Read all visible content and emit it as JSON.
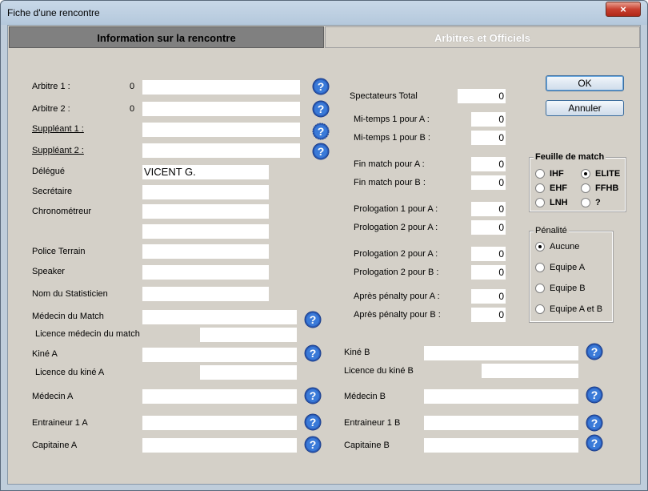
{
  "window": {
    "title": "Fiche d'une rencontre",
    "close": "×"
  },
  "tabs": [
    {
      "label": "Information sur la rencontre"
    },
    {
      "label": "Arbitres et Officiels"
    }
  ],
  "left": {
    "arbitre1": {
      "label": "Arbitre 1 :",
      "count": "0",
      "value": ""
    },
    "arbitre2": {
      "label": "Arbitre 2 :",
      "count": "0",
      "value": ""
    },
    "suppleant1": {
      "label": "Suppléant 1 :",
      "value": ""
    },
    "suppleant2": {
      "label": "Suppléant 2 :",
      "value": ""
    },
    "delegue": {
      "label": "Délégué",
      "value": "VICENT G."
    },
    "secretaire": {
      "label": "Secrétaire",
      "value": ""
    },
    "chronometreur": {
      "label": "Chronométreur",
      "value": "",
      "value2": ""
    },
    "police": {
      "label": "Police Terrain",
      "value": ""
    },
    "speaker": {
      "label": "Speaker",
      "value": ""
    },
    "statisticien": {
      "label": "Nom du Statisticien",
      "value": ""
    },
    "medecin_match": {
      "label": "Médecin du Match",
      "value": ""
    },
    "licence_medecin": {
      "label": "Licence médecin du match",
      "value": ""
    },
    "kine_a": {
      "label": "Kiné A",
      "value": ""
    },
    "licence_kine_a": {
      "label": "Licence du kiné A",
      "value": ""
    },
    "medecin_a": {
      "label": "Médecin A",
      "value": ""
    },
    "entraineur_a": {
      "label": "Entraineur 1 A",
      "value": ""
    },
    "capitaine_a": {
      "label": "Capitaine A",
      "value": ""
    }
  },
  "right": {
    "kine_b": {
      "label": "Kiné B",
      "value": ""
    },
    "licence_kine_b": {
      "label": "Licence du kiné B",
      "value": ""
    },
    "medecin_b": {
      "label": "Médecin B",
      "value": ""
    },
    "entraineur_b": {
      "label": "Entraineur 1 B",
      "value": ""
    },
    "capitaine_b": {
      "label": "Capitaine B",
      "value": ""
    }
  },
  "stats": {
    "spectateurs": {
      "label": "Spectateurs Total",
      "value": "0"
    },
    "mitemps1a": {
      "label": "Mi-temps 1 pour A :",
      "value": "0"
    },
    "mitemps1b": {
      "label": "Mi-temps 1 pour B :",
      "value": "0"
    },
    "finmatcha": {
      "label": "Fin match pour A :",
      "value": "0"
    },
    "finmatchb": {
      "label": "Fin match pour B :",
      "value": "0"
    },
    "prolog1a": {
      "label": "Prologation 1 pour A :",
      "value": "0"
    },
    "prolog2a": {
      "label": "Prologation 2 pour A :",
      "value": "0"
    },
    "prolog2a_b": {
      "label": "Prologation 2 pour A :",
      "value": "0"
    },
    "prolog2b": {
      "label": "Prologation 2 pour B :",
      "value": "0"
    },
    "penaltya": {
      "label": "Après pénalty pour A :",
      "value": "0"
    },
    "penaltyb": {
      "label": "Après pénalty pour B :",
      "value": "0"
    }
  },
  "buttons": {
    "ok": "OK",
    "cancel": "Annuler"
  },
  "feuille": {
    "title": "Feuille de match",
    "options": [
      "IHF",
      "ELITE",
      "EHF",
      "FFHB",
      "LNH",
      "?"
    ],
    "selected": "ELITE"
  },
  "penalite": {
    "title": "Pénalité",
    "options": [
      "Aucune",
      "Equipe A",
      "Equipe B",
      "Equipe A et B"
    ],
    "selected": "Aucune"
  },
  "icons": {
    "help": "help-question-icon"
  }
}
